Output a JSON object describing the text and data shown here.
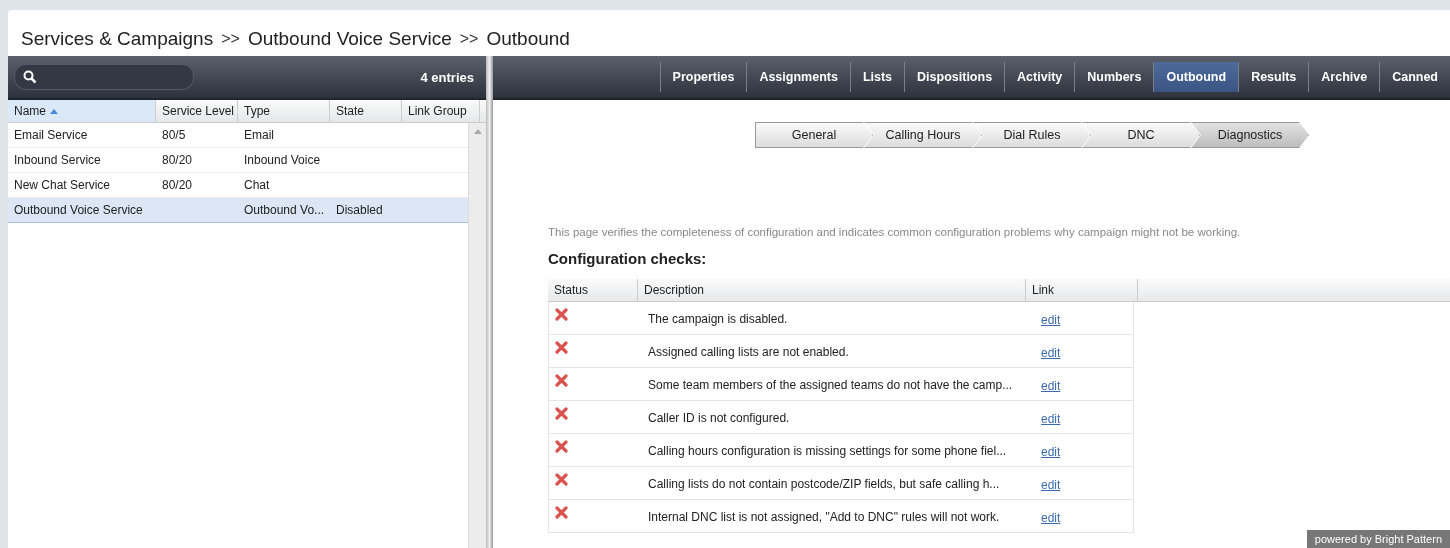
{
  "breadcrumb": {
    "parts": [
      "Services & Campaigns",
      "Outbound Voice Service",
      "Outbound"
    ],
    "separator": ">>"
  },
  "list": {
    "entries": "4 entries",
    "columns": [
      {
        "label": "Name",
        "sorted": true
      },
      {
        "label": "Service Level",
        "sorted": false
      },
      {
        "label": "Type",
        "sorted": false
      },
      {
        "label": "State",
        "sorted": false
      },
      {
        "label": "Link Group",
        "sorted": false
      }
    ],
    "rows": [
      {
        "cells": [
          "Email Service",
          "80/5",
          "Email",
          "",
          ""
        ],
        "selected": false
      },
      {
        "cells": [
          "Inbound Service",
          "80/20",
          "Inbound Voice",
          "",
          ""
        ],
        "selected": false
      },
      {
        "cells": [
          "New Chat Service",
          "80/20",
          "Chat",
          "",
          ""
        ],
        "selected": false
      },
      {
        "cells": [
          "Outbound Voice Service",
          "",
          "Outbound Vo...",
          "Disabled",
          ""
        ],
        "selected": true
      }
    ]
  },
  "tabs": [
    {
      "label": "Properties",
      "selected": false
    },
    {
      "label": "Assignments",
      "selected": false
    },
    {
      "label": "Lists",
      "selected": false
    },
    {
      "label": "Dispositions",
      "selected": false
    },
    {
      "label": "Activity",
      "selected": false
    },
    {
      "label": "Numbers",
      "selected": false
    },
    {
      "label": "Outbound",
      "selected": true
    },
    {
      "label": "Results",
      "selected": false
    },
    {
      "label": "Archive",
      "selected": false
    },
    {
      "label": "Canned",
      "selected": false
    }
  ],
  "steps": [
    {
      "label": "General",
      "selected": false
    },
    {
      "label": "Calling Hours",
      "selected": false
    },
    {
      "label": "Dial Rules",
      "selected": false
    },
    {
      "label": "DNC",
      "selected": false
    },
    {
      "label": "Diagnostics",
      "selected": true
    }
  ],
  "intro": "This page verifies the completeness of configuration and indicates common configuration problems why campaign might not be working.",
  "checks_title": "Configuration checks:",
  "checks": {
    "columns": [
      "Status",
      "Description",
      "Link"
    ],
    "rows": [
      {
        "passed": false,
        "description": "The campaign is disabled.",
        "link": "edit"
      },
      {
        "passed": false,
        "description": "Assigned calling lists are not enabled.",
        "link": "edit"
      },
      {
        "passed": false,
        "description": "Some team members of the assigned teams do not have the camp...",
        "link": "edit"
      },
      {
        "passed": false,
        "description": "Caller ID is not configured.",
        "link": "edit"
      },
      {
        "passed": false,
        "description": "Calling hours configuration is missing settings for some phone fiel...",
        "link": "edit"
      },
      {
        "passed": false,
        "description": "Calling lists do not contain postcode/ZIP fields, but safe calling h...",
        "link": "edit"
      },
      {
        "passed": false,
        "description": "Internal DNC list is not assigned, \"Add to DNC\" rules will not work.",
        "link": "edit"
      }
    ]
  },
  "footer_badge": "powered by Bright Pattern"
}
